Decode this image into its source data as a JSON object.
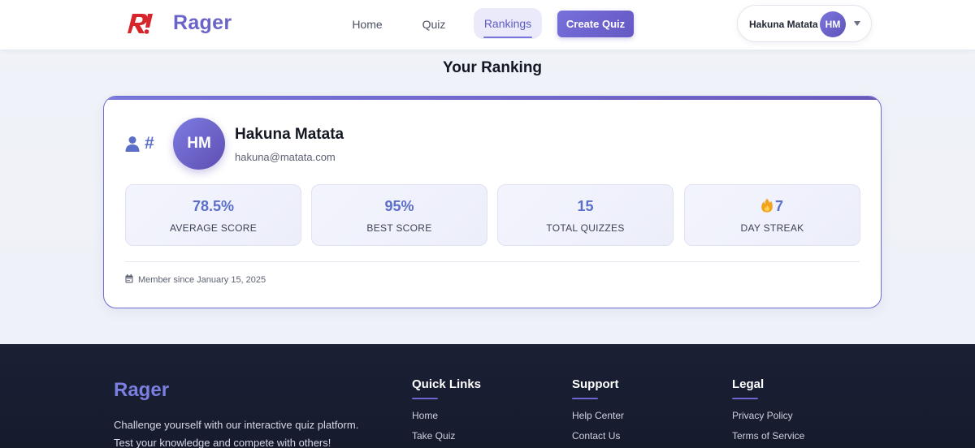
{
  "header": {
    "brand": "Rager",
    "nav": [
      {
        "label": "Home"
      },
      {
        "label": "Quiz"
      },
      {
        "label": "Rankings"
      }
    ],
    "create_button": "Create Quiz",
    "user": {
      "name": "Hakuna Matata",
      "initials": "HM"
    }
  },
  "ranking": {
    "title": "Your Ranking",
    "rank_prefix": "#",
    "profile": {
      "initials": "HM",
      "name": "Hakuna Matata",
      "email": "hakuna@matata.com"
    },
    "stats": [
      {
        "value": "78.5%",
        "label": "AVERAGE SCORE"
      },
      {
        "value": "95%",
        "label": "BEST SCORE"
      },
      {
        "value": "15",
        "label": "TOTAL QUIZZES"
      },
      {
        "value": "7",
        "label": "DAY STREAK"
      }
    ],
    "member_since": "Member since January 15, 2025"
  },
  "footer": {
    "brand": "Rager",
    "description": "Challenge yourself with our interactive quiz platform. Test your knowledge and compete with others!",
    "columns": [
      {
        "heading": "Quick Links",
        "links": [
          "Home",
          "Take Quiz"
        ]
      },
      {
        "heading": "Support",
        "links": [
          "Help Center",
          "Contact Us"
        ]
      },
      {
        "heading": "Legal",
        "links": [
          "Privacy Policy",
          "Terms of Service"
        ]
      }
    ]
  },
  "colors": {
    "accent": "#6a64c9",
    "stat_value": "#5b6fc9",
    "footer_bg": "#1a2035",
    "logo_red": "#d7262b"
  },
  "icons": [
    "logo-icon",
    "user-icon",
    "chevron-down-icon",
    "fire-icon",
    "calendar-icon"
  ]
}
